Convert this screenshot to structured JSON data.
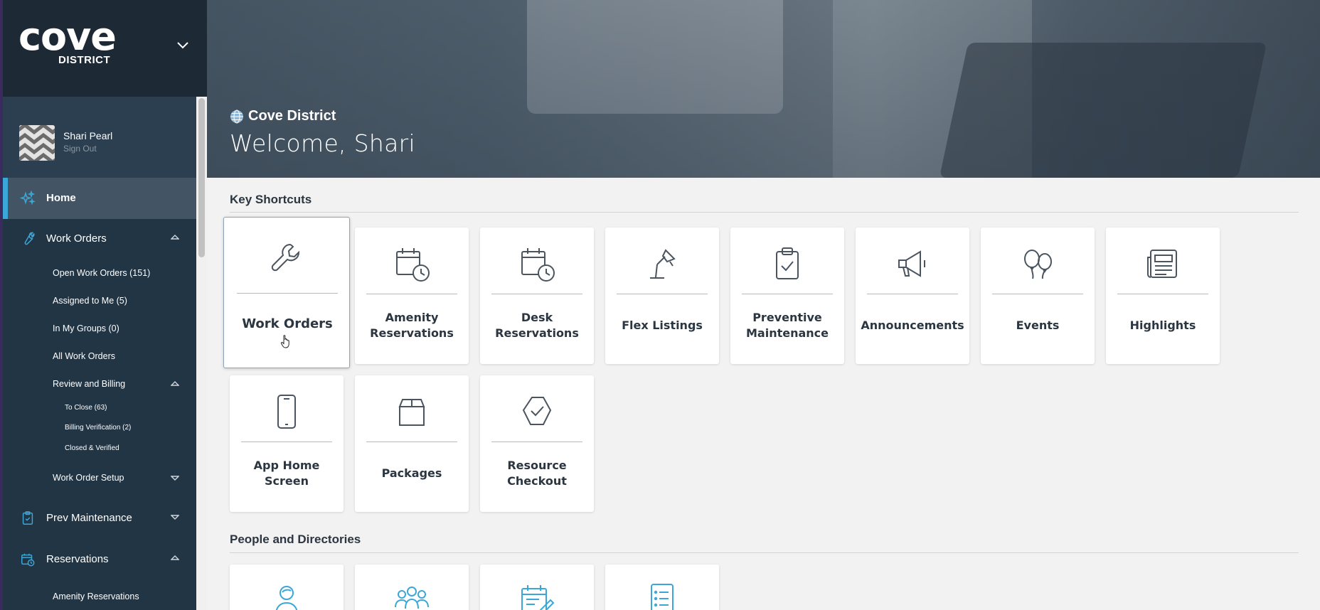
{
  "sidebar": {
    "logo_word": "cove",
    "logo_sub": "DISTRICT",
    "user_name": "Shari Pearl",
    "sign_out": "Sign Out",
    "home": "Home",
    "work_orders": "Work Orders",
    "work_order_items": [
      "Open Work Orders (151)",
      "Assigned to Me (5)",
      "In My Groups (0)",
      "All Work Orders"
    ],
    "review_billing": "Review and Billing",
    "review_items": [
      "To Close (63)",
      "Billing Verification (2)",
      "Closed & Verified"
    ],
    "work_order_setup": "Work Order Setup",
    "prev_maintenance": "Prev Maintenance",
    "reservations": "Reservations",
    "amenity_reservations": "Amenity Reservations"
  },
  "hero": {
    "site_name": "Cove District",
    "welcome": "Welcome, Shari"
  },
  "sections": {
    "key_shortcuts": "Key Shortcuts",
    "people_directories": "People and Directories"
  },
  "shortcuts": [
    {
      "label": "Work Orders",
      "icon": "wrench-icon"
    },
    {
      "label": "Amenity\nReservations",
      "icon": "calendar-clock-icon"
    },
    {
      "label": "Desk\nReservations",
      "icon": "calendar-clock-icon"
    },
    {
      "label": "Flex Listings",
      "icon": "desk-lamp-icon"
    },
    {
      "label": "Preventive\nMaintenance",
      "icon": "clipboard-check-icon"
    },
    {
      "label": "Announcements",
      "icon": "megaphone-icon"
    },
    {
      "label": "Events",
      "icon": "balloons-icon"
    },
    {
      "label": "Highlights",
      "icon": "newspaper-icon"
    },
    {
      "label": "App Home\nScreen",
      "icon": "phone-icon"
    },
    {
      "label": "Packages",
      "icon": "package-icon"
    },
    {
      "label": "Resource\nCheckout",
      "icon": "hexagon-check-icon"
    }
  ],
  "people_icons": [
    "person-icon",
    "group-icon",
    "calendar-edit-icon",
    "list-icon"
  ],
  "colors": {
    "accent": "#3aa7d8",
    "sidebar": "#223545",
    "icon": "#4a5560"
  }
}
